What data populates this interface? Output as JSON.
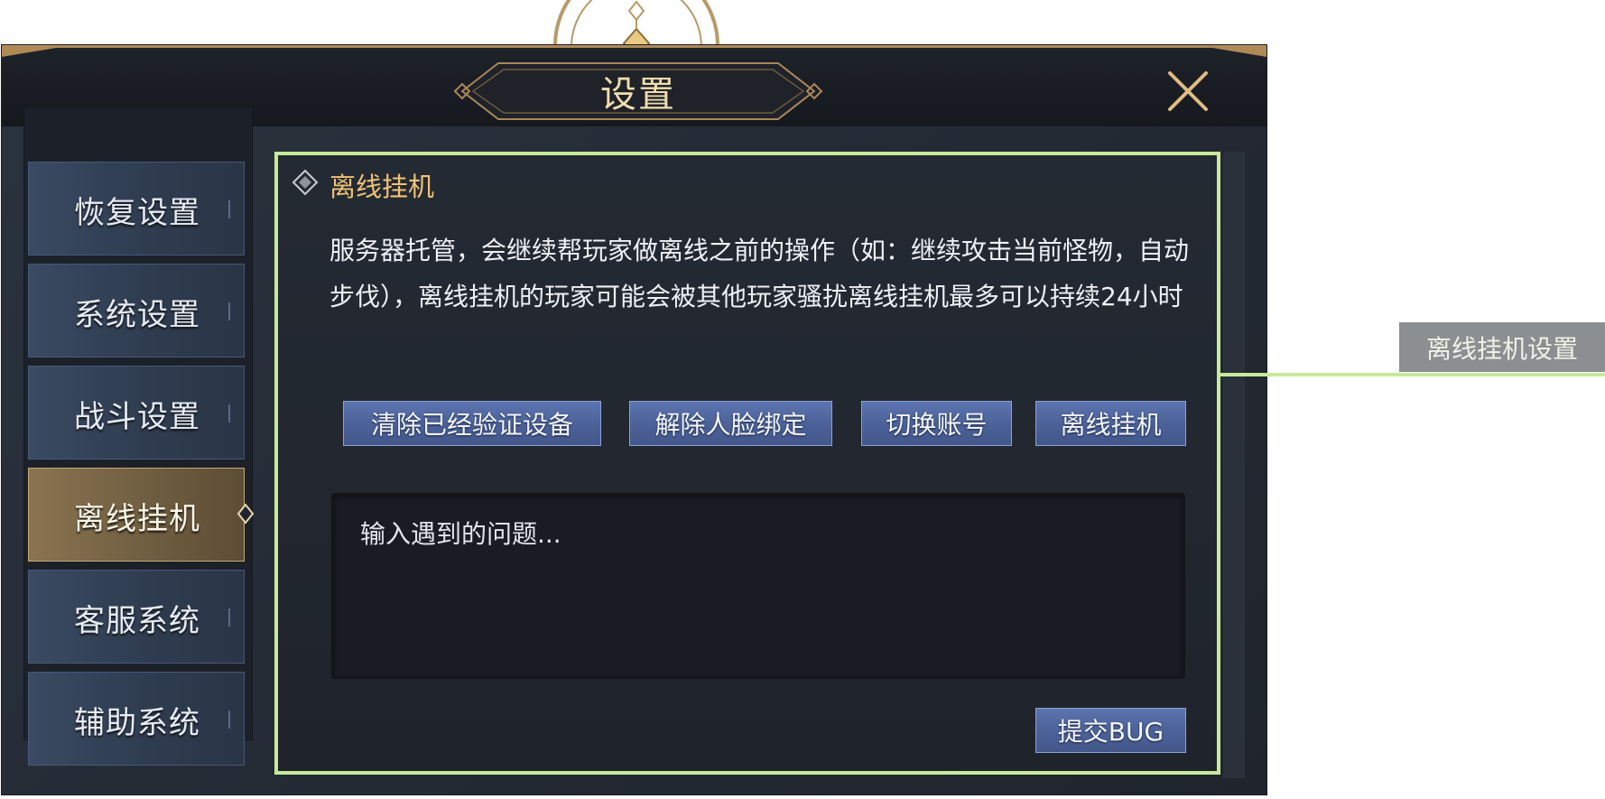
{
  "window": {
    "title": "设置"
  },
  "sidebar": {
    "items": [
      {
        "label": "恢复设置",
        "active": false
      },
      {
        "label": "系统设置",
        "active": false
      },
      {
        "label": "战斗设置",
        "active": false
      },
      {
        "label": "离线挂机",
        "active": true
      },
      {
        "label": "客服系统",
        "active": false
      },
      {
        "label": "辅助系统",
        "active": false
      }
    ]
  },
  "panel": {
    "section_title": "离线挂机",
    "description": "服务器托管，会继续帮玩家做离线之前的操作（如：继续攻击当前怪物，自动步伐），离线挂机的玩家可能会被其他玩家骚扰离线挂机最多可以持续24小时",
    "buttons": {
      "clear_devices": "清除已经验证设备",
      "unbind_face": "解除人脸绑定",
      "switch_account": "切换账号",
      "offline_idle": "离线挂机"
    },
    "feedback": {
      "placeholder": "输入遇到的问题..."
    },
    "submit_label": "提交BUG"
  },
  "callout": {
    "label": "离线挂机设置"
  },
  "colors": {
    "highlight_border": "#c7ea9a",
    "title_gold": "#f1c277",
    "button_blue": "#4c6299",
    "active_tab_gold": "#8a7450"
  }
}
